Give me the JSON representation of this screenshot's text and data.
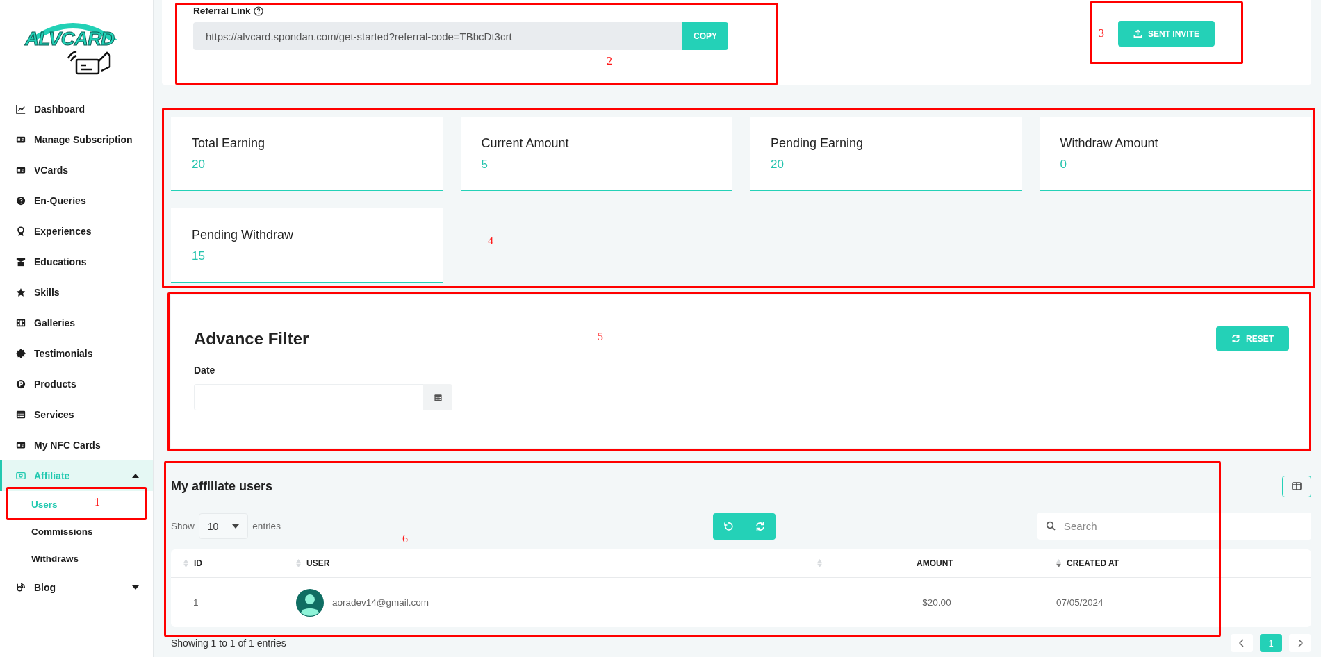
{
  "logo": {
    "text": "ALVCARD"
  },
  "sidebar": {
    "items": [
      {
        "label": "Dashboard",
        "selected": false
      },
      {
        "label": "Manage Subscription",
        "selected": false
      },
      {
        "label": "VCards",
        "selected": false
      },
      {
        "label": "En-Queries",
        "selected": false
      },
      {
        "label": "Experiences",
        "selected": false
      },
      {
        "label": "Educations",
        "selected": false
      },
      {
        "label": "Skills",
        "selected": false
      },
      {
        "label": "Galleries",
        "selected": false
      },
      {
        "label": "Testimonials",
        "selected": false
      },
      {
        "label": "Products",
        "selected": false
      },
      {
        "label": "Services",
        "selected": false
      },
      {
        "label": "My NFC Cards",
        "selected": false
      },
      {
        "label": "Affiliate",
        "selected": true,
        "expanded": true,
        "children": [
          {
            "label": "Users",
            "selected": true,
            "annotation": "1"
          },
          {
            "label": "Commissions",
            "selected": false
          },
          {
            "label": "Withdraws",
            "selected": false
          }
        ]
      },
      {
        "label": "Blog",
        "selected": false,
        "expanded": false
      }
    ]
  },
  "referral": {
    "label": "Referral Link",
    "value": "https://alvcard.spondan.com/get-started?referral-code=TBbcDt3crt",
    "copy_button": "COPY",
    "annotation": "2"
  },
  "invite_button": {
    "label": "SENT INVITE",
    "annotation": "3"
  },
  "stats": {
    "annotation": "4",
    "cards": [
      {
        "label": "Total Earning",
        "value": "20"
      },
      {
        "label": "Current Amount",
        "value": "5"
      },
      {
        "label": "Pending Earning",
        "value": "20"
      },
      {
        "label": "Withdraw Amount",
        "value": "0"
      },
      {
        "label": "Pending Withdraw",
        "value": "15"
      }
    ]
  },
  "filter": {
    "annotation": "5",
    "title": "Advance Filter",
    "reset_button": "RESET",
    "date_label": "Date"
  },
  "table_section": {
    "annotation": "6",
    "title": "My affiliate users",
    "show_label": "Show",
    "page_size": "10",
    "entries_label": "entries",
    "search_placeholder": "Search",
    "columns": [
      {
        "label": "ID",
        "sorted": false
      },
      {
        "label": "USER",
        "sorted": false
      },
      {
        "label": "AMOUNT",
        "sorted": false
      },
      {
        "label": "CREATED AT",
        "sorted": true
      }
    ],
    "rows": [
      {
        "id": "1",
        "user": "aoradev14@gmail.com",
        "amount": "$20.00",
        "created_at": "07/05/2024"
      }
    ],
    "footer": "Showing 1 to 1 of 1 entries",
    "pages": [
      {
        "label": "1",
        "selected": true
      }
    ]
  }
}
